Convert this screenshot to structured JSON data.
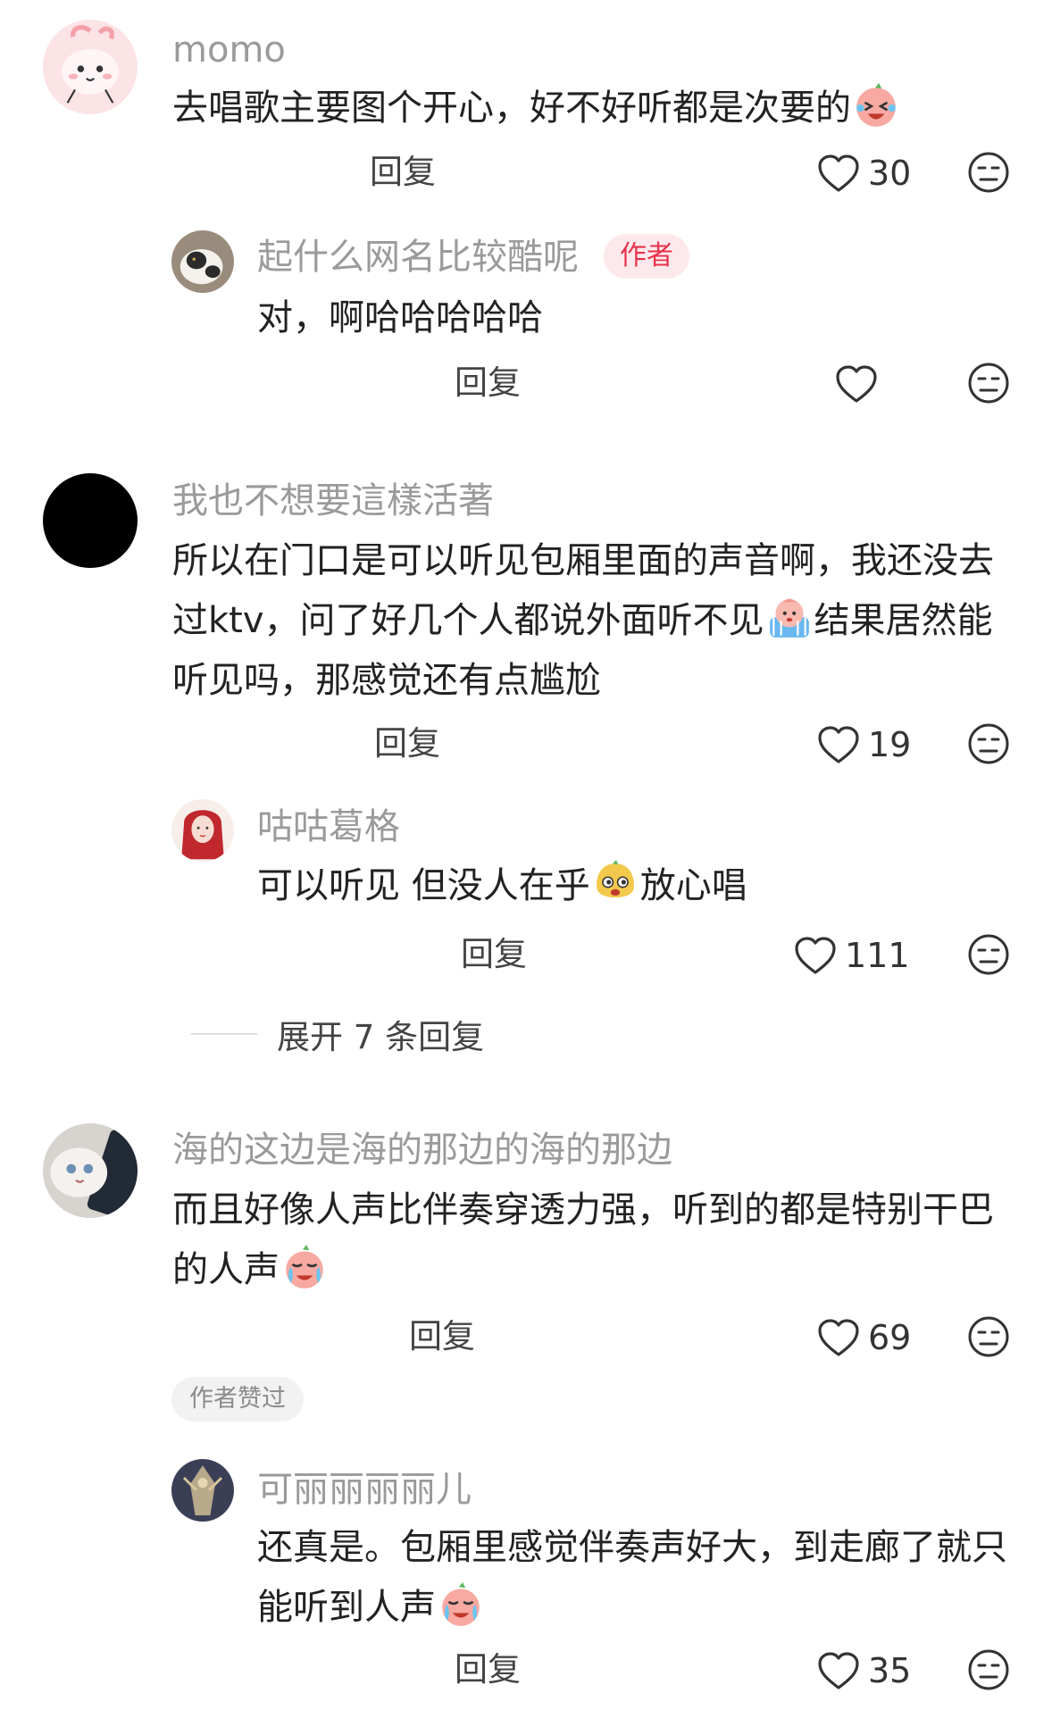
{
  "comments": [
    {
      "user": "momo",
      "text": "去唱歌主要图个开心，好不好听都是次要的",
      "emoji": "laughing-crying-emoji",
      "reply_label": "回复",
      "likes": "30",
      "replies": [
        {
          "user": "起什么网名比较酷呢",
          "badge": "作者",
          "text": "对，啊哈哈哈哈哈",
          "reply_label": "回复",
          "likes": ""
        }
      ]
    },
    {
      "user": "我也不想要這樣活著",
      "text_a": "所以在门口是可以听见包厢里面的声音啊，我还没去过ktv，问了好几个人都说外面听不见",
      "emoji": "shy-emoji",
      "text_b": "结果居然能听见吗，那感觉还有点尴尬",
      "reply_label": "回复",
      "likes": "19",
      "replies": [
        {
          "user": "咕咕葛格",
          "text_a": "可以听见 但没人在乎",
          "emoji": "cheeky-emoji",
          "text_b": "放心唱",
          "reply_label": "回复",
          "likes": "111"
        }
      ],
      "expand_label": "展开 7 条回复"
    },
    {
      "user": "海的这边是海的那边的海的那边",
      "text": "而且好像人声比伴奏穿透力强，听到的都是特别干巴的人声",
      "emoji": "crying-emoji",
      "reply_label": "回复",
      "likes": "69",
      "liked_badge": "作者赞过",
      "replies": [
        {
          "user": "可丽丽丽丽儿",
          "text": "还真是。包厢里感觉伴奏声好大，到走廊了就只能听到人声",
          "emoji": "crying-emoji",
          "reply_label": "回复",
          "likes": "35"
        }
      ]
    }
  ],
  "icons": {
    "like": "heart-outline-icon",
    "dislike": "neutral-face-icon"
  },
  "colors": {
    "author_badge_bg": "#fde9ec",
    "author_badge_text": "#e8324b",
    "username": "#9a9a9a"
  }
}
